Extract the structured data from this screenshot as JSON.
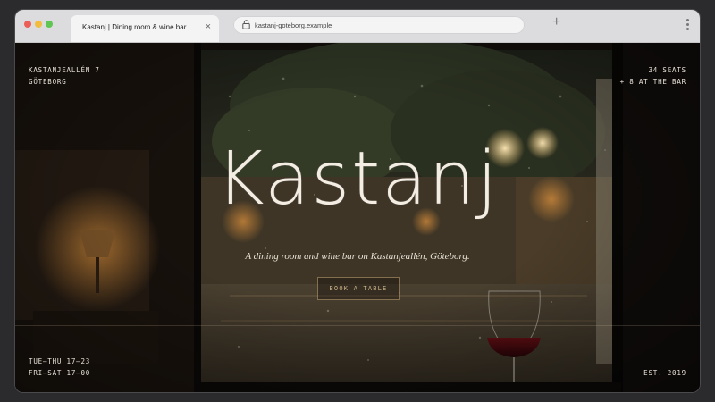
{
  "browser": {
    "tab_title": "Kastanj | Dining room & wine bar",
    "tab_close": "×",
    "url": "kastanj-goteborg.example",
    "new_tab": "+"
  },
  "site": {
    "address_line1": "KASTANJEALLÉN 7",
    "address_line2": "GÖTEBORG",
    "seats_line1": "34 SEATS",
    "seats_line2": "+ 8 AT THE BAR",
    "brand": "Kastanj",
    "tagline": "A dining room and wine bar on Kastanjeallén, Göteborg.",
    "book_label": "BOOK A TABLE",
    "hours_line1": "TUE–THU 17–23",
    "hours_line2": "FRI–SAT 17–00",
    "established": "EST. 2019"
  },
  "colors": {
    "accent": "#cdb38a",
    "text": "#e8e2d8"
  }
}
